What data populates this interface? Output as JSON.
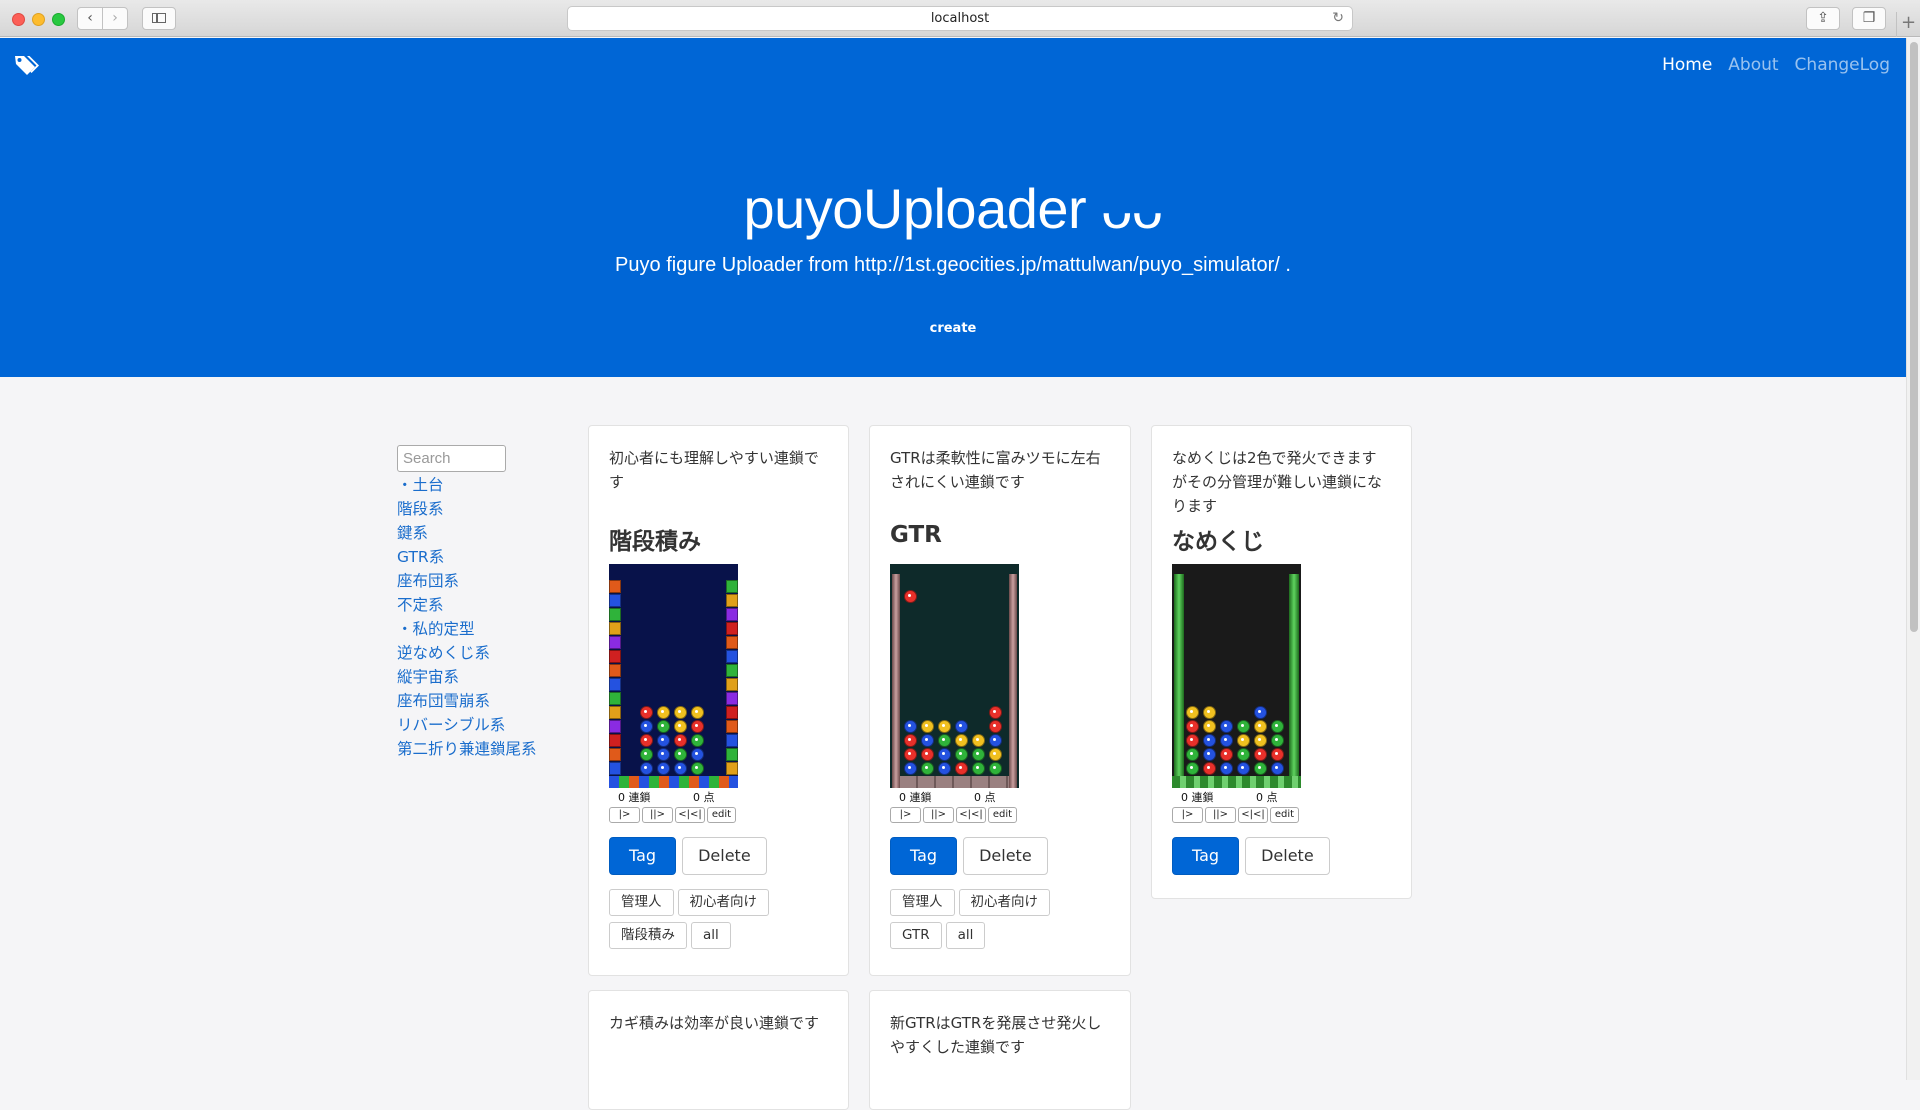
{
  "browser": {
    "url": "localhost"
  },
  "nav": {
    "items": [
      "Home",
      "About",
      "ChangeLog"
    ]
  },
  "hero": {
    "title": "puyoUploader",
    "title_face": "ᴗᴗ",
    "subtitle": "Puyo figure Uploader from http://1st.geocities.jp/mattulwan/puyo_simulator/ .",
    "create_label": "create"
  },
  "sidebar": {
    "search_placeholder": "Search",
    "items": [
      "・土台",
      "階段系",
      "鍵系",
      "GTR系",
      "座布団系",
      "不定系",
      "・私的定型",
      "逆なめくじ系",
      "縦宇宙系",
      "座布団雪崩系",
      "リバーシブル系",
      "第二折り兼連鎖尾系"
    ]
  },
  "cards": [
    {
      "desc": "初心者にも理解しやすい連鎖です",
      "title": "階段積み",
      "chain_label": "0 連鎖",
      "score_label": "0 点",
      "controls": [
        "|>",
        "||>",
        "<|<|",
        "edit"
      ],
      "tag_label": "Tag",
      "delete_label": "Delete",
      "tags": [
        "管理人",
        "初心者向け",
        "階段積み",
        "all"
      ]
    },
    {
      "desc": "GTRは柔軟性に富みツモに左右されにくい連鎖です",
      "title": "GTR",
      "chain_label": "0 連鎖",
      "score_label": "0 点",
      "controls": [
        "|>",
        "||>",
        "<|<|",
        "edit"
      ],
      "tag_label": "Tag",
      "delete_label": "Delete",
      "tags": [
        "管理人",
        "初心者向け",
        "GTR",
        "all"
      ]
    },
    {
      "desc": "なめくじは2色で発火できますがその分管理が難しい連鎖になります",
      "title": "なめくじ",
      "chain_label": "0 連鎖",
      "score_label": "0 点",
      "controls": [
        "|>",
        "||>",
        "<|<|",
        "edit"
      ],
      "tag_label": "Tag",
      "delete_label": "Delete",
      "tags": []
    },
    {
      "desc": "カギ積みは効率が良い連鎖です"
    },
    {
      "desc": "新GTRはGTRを発展させ発火しやすくした連鎖です"
    }
  ],
  "colors": {
    "primary": "#0066d6",
    "link": "#1a6dcc",
    "background": "#f5f5f7"
  }
}
